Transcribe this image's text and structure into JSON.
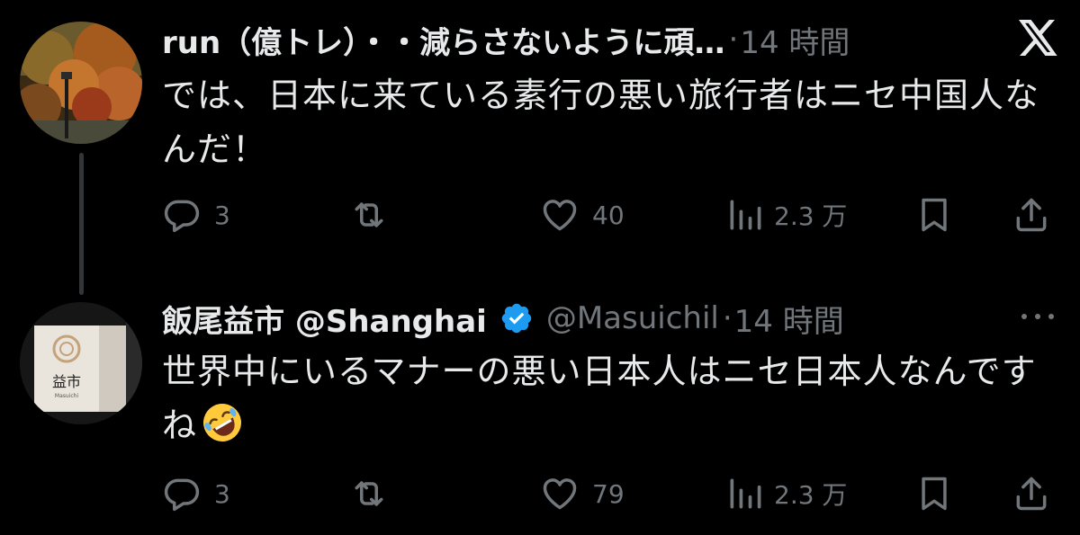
{
  "tweets": [
    {
      "display_name": "run（億トレ）・・減らさないように頑…",
      "handle": "",
      "separator": "·",
      "time": "14 時間",
      "text": "では、日本に来ている素行の悪い旅行者はニセ中国人なんだ！",
      "avatar_icon": "autumn-foliage-avatar",
      "corner_icon": "x-logo-icon",
      "replies": "3",
      "retweets": "",
      "likes": "40",
      "views": "2.3 万",
      "verified": false
    },
    {
      "display_name": "飯尾益市 @Shanghai",
      "handle": "@Masuichil",
      "separator": "·",
      "time": "14 時間",
      "text": "世界中にいるマナーの悪い日本人はニセ日本人なんですね",
      "emoji": "rolling-on-floor-laughing-emoji",
      "avatar_icon": "masuichi-sign-avatar",
      "avatar_sign_text": "益市",
      "avatar_sign_sub": "Masuichi",
      "corner_icon": "more-icon",
      "replies": "3",
      "retweets": "",
      "likes": "79",
      "views": "2.3 万",
      "verified": true
    }
  ],
  "colors": {
    "background": "#000000",
    "primary_text": "#e7e9ea",
    "secondary_text": "#71767b",
    "verified_badge": "#1d9bf0",
    "thread_line": "#333639"
  }
}
